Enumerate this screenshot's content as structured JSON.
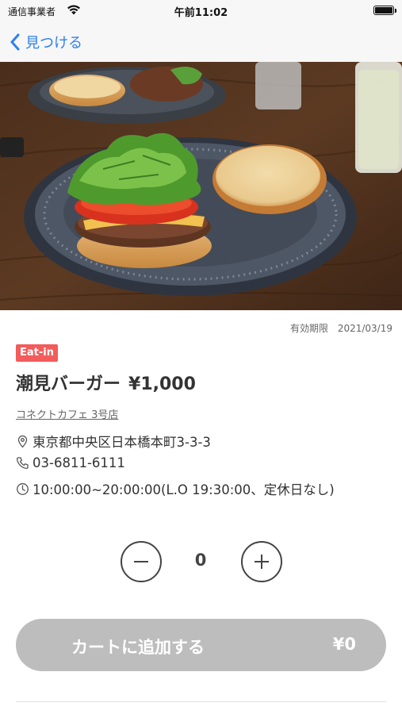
{
  "status_bar": {
    "carrier": "通信事業者",
    "time": "午前11:02",
    "battery_level": 1.0
  },
  "nav": {
    "back_label": "見つける",
    "back_icon": "chevron-left-icon"
  },
  "product": {
    "expiry_label": "有効期限",
    "expiry_date": "2021/03/19",
    "badge": "Eat-in",
    "name": "潮見バーガー",
    "price": "¥1,000",
    "shop_name": "コネクトカフェ 3号店",
    "address": "東京都中央区日本橋本町3-3-3",
    "phone": "03-6811-6111",
    "hours": "10:00:00~20:00:00(L.O 19:30:00、定休日なし)"
  },
  "stepper": {
    "quantity": "0"
  },
  "cart": {
    "label": "カートに追加する",
    "total": "¥0"
  },
  "colors": {
    "accent": "#2f80ed",
    "badge": "#f25c5c",
    "cart_button_disabled": "#bdbdbd"
  }
}
